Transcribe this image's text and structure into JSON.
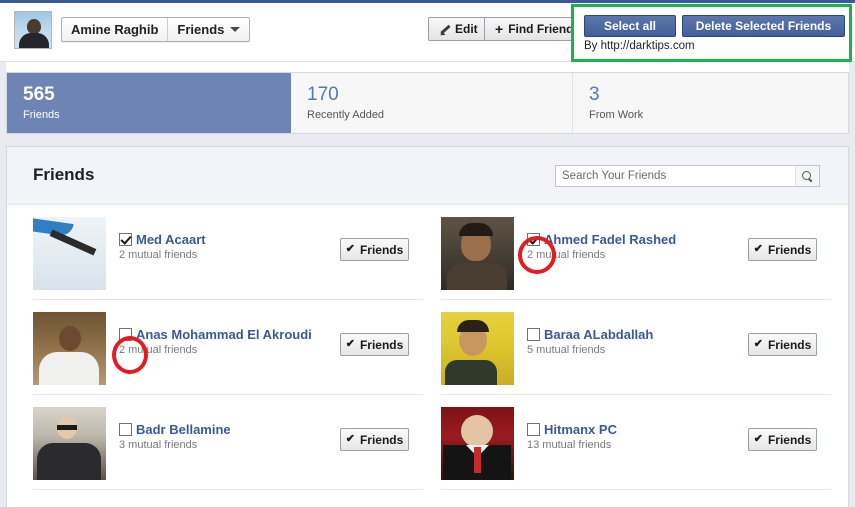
{
  "header": {
    "profile_name": "Amine Raghib",
    "section_label": "Friends",
    "caret_icon": "chevron-down-icon",
    "edit_button": "Edit",
    "edit_icon": "pencil-icon",
    "find_friends_button": "Find Friends",
    "find_friends_icon": "plus-icon",
    "avatar_icon": "user-avatar"
  },
  "annotation": {
    "select_all_button": "Select all",
    "delete_selected_button": "Delete Selected Friends",
    "credit": "By http://darktips.com",
    "box_color": "#1db24a",
    "button_color": "#4a66a0",
    "ring_color": "#e31b23"
  },
  "stats": [
    {
      "number": "565",
      "label": "Friends",
      "active": true
    },
    {
      "number": "170",
      "label": "Recently Added",
      "active": false
    },
    {
      "number": "3",
      "label": "From Work",
      "active": false
    }
  ],
  "panel": {
    "title": "Friends",
    "search_placeholder": "Search Your Friends",
    "search_value": "",
    "search_icon": "magnifier-icon"
  },
  "friends": {
    "left": [
      {
        "name": "Med Acaart",
        "mutual": "2 mutual friends",
        "checked": true,
        "action_label": "Friends",
        "action_icon": "check-icon",
        "thumb": "th-pencil"
      },
      {
        "name": "Anas Mohammad El Akroudi",
        "mutual": "2 mutual friends",
        "checked": false,
        "action_label": "Friends",
        "action_icon": "check-icon",
        "thumb": "th-anas"
      },
      {
        "name": "Badr Bellamine",
        "mutual": "3 mutual friends",
        "checked": false,
        "action_label": "Friends",
        "action_icon": "check-icon",
        "thumb": "th-badr"
      }
    ],
    "right": [
      {
        "name": "Ahmed Fadel Rashed",
        "mutual": "2 mutual friends",
        "checked": true,
        "action_label": "Friends",
        "action_icon": "check-icon",
        "thumb": "th-ahmed"
      },
      {
        "name": "Baraa ALabdallah",
        "mutual": "5 mutual friends",
        "checked": false,
        "action_label": "Friends",
        "action_icon": "check-icon",
        "thumb": "th-baraa"
      },
      {
        "name": "Hitmanx PC",
        "mutual": "13 mutual friends",
        "checked": false,
        "action_label": "Friends",
        "action_icon": "check-icon",
        "thumb": "th-hitman"
      }
    ]
  },
  "glyphs": {
    "check": "✔",
    "plus": "+"
  }
}
